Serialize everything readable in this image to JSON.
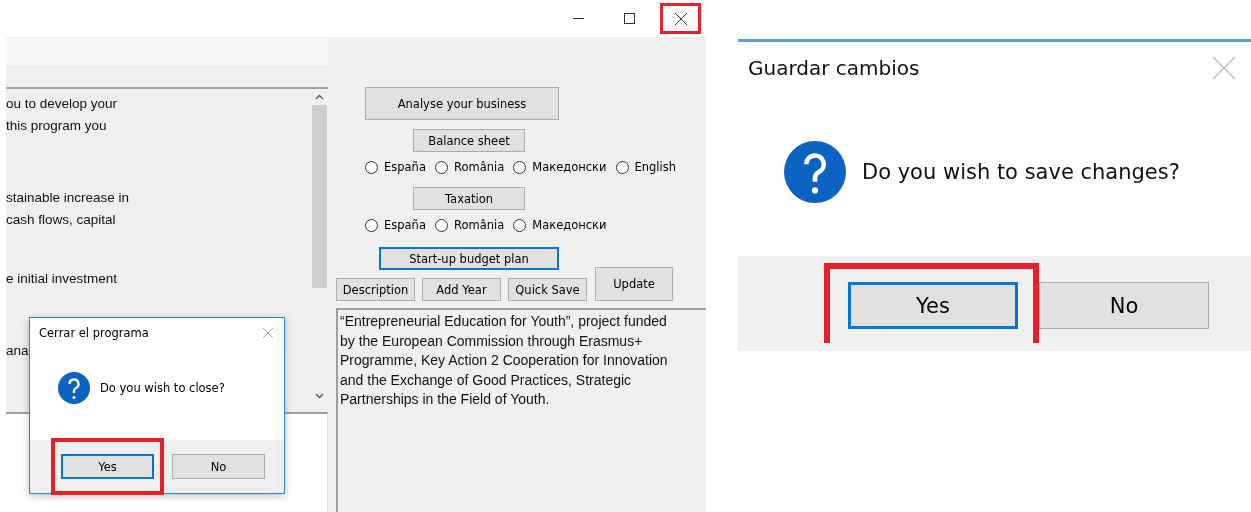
{
  "main_window": {
    "title_bar": {
      "buttons": [
        {
          "kind": "minimize",
          "highlighted": false
        },
        {
          "kind": "maximize",
          "highlighted": false
        },
        {
          "kind": "close",
          "highlighted": true
        }
      ]
    },
    "info_text": [
      [
        "ou to develop your",
        "this program you"
      ],
      [
        "stainable increase in",
        "cash flows, capital"
      ],
      [
        "e initial investment"
      ],
      [
        "ana"
      ]
    ],
    "analyse_button": "Analyse your business",
    "balance_button": "Balance sheet",
    "balance_languages": [
      {
        "label": "España",
        "selected": false
      },
      {
        "label": "România",
        "selected": false
      },
      {
        "label": "Македонски",
        "selected": false
      },
      {
        "label": "English",
        "selected": false
      }
    ],
    "taxation_button": "Taxation",
    "taxation_languages": [
      {
        "label": "España",
        "selected": false
      },
      {
        "label": "România",
        "selected": false
      },
      {
        "label": "Македонски",
        "selected": false
      }
    ],
    "budget_button": {
      "label": "Start-up budget plan",
      "focused": true
    },
    "action_buttons": [
      "Description",
      "Add Year",
      "Quick Save"
    ],
    "update_button": "Update",
    "project_text": "“Entrepreneurial Education for Youth”, project funded by the European  Commission  through Erasmus+  Programme,  Key Action 2 Cooperation for Innovation and the Exchange of Good Practices, Strategic Partnerships in the Field of Youth.",
    "dialog": {
      "title": "Cerrar el programa",
      "message": "Do you wish to close?",
      "buttons": [
        {
          "label": "Yes",
          "focused": true,
          "highlighted": true
        },
        {
          "label": "No",
          "focused": false,
          "highlighted": false
        }
      ]
    }
  },
  "save_dialog": {
    "title": "Guardar cambios",
    "message": "Do you wish to save changes?",
    "buttons": [
      {
        "label": "Yes",
        "focused": true,
        "highlighted": true
      },
      {
        "label": "No",
        "focused": false,
        "highlighted": false
      }
    ]
  }
}
